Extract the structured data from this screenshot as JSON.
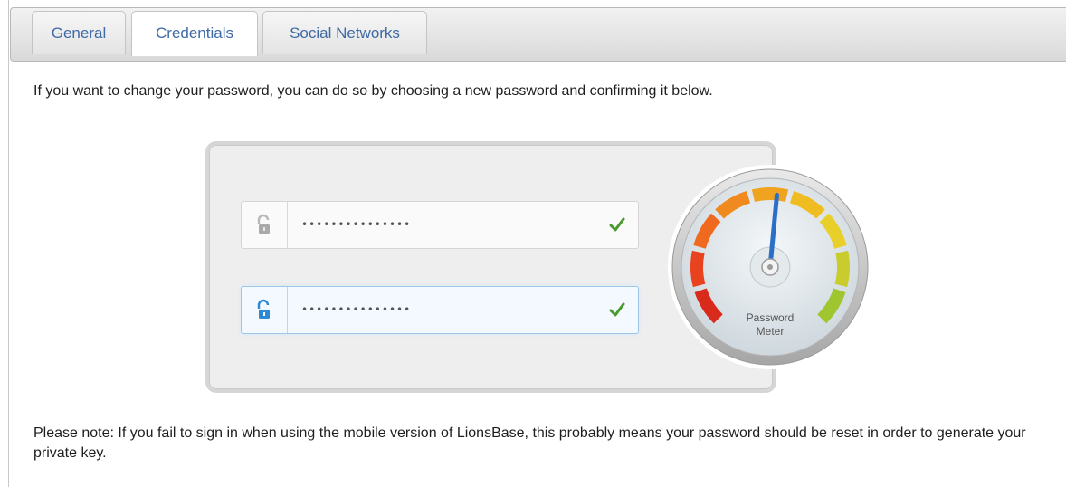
{
  "tabs": [
    {
      "label": "General",
      "active": false
    },
    {
      "label": "Credentials",
      "active": true
    },
    {
      "label": "Social Networks",
      "active": false
    }
  ],
  "intro_text": "If you want to change your password, you can do so by choosing a new password and confirming it below.",
  "password_fields": [
    {
      "value": "•••••••••••••••",
      "status": "valid",
      "focused": false
    },
    {
      "value": "•••••••••••••••",
      "status": "valid",
      "focused": true
    }
  ],
  "password_meter": {
    "label_line1": "Password",
    "label_line2": "Meter",
    "strength_fraction": 0.52
  },
  "note_text": "Please note: If you fail to sign in when using the mobile version of LionsBase, this probably means your password should be reset in order to generate your private key.",
  "colors": {
    "tab_text": "#3f6aa6",
    "valid_check": "#4a9a2f",
    "focus_lock": "#2a8ad6",
    "needle": "#2a6ec8"
  }
}
